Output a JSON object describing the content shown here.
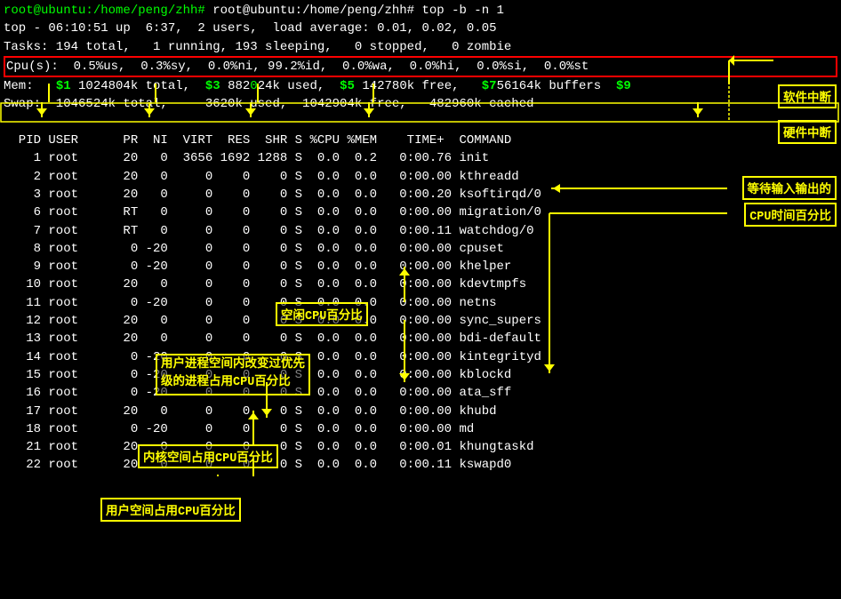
{
  "terminal": {
    "title": "root@ubuntu:/home/peng/zhh# top -b -n 1",
    "lines": {
      "cmd": "root@ubuntu:/home/peng/zhh# top -b -n 1",
      "top_status": "top - 06:10:51 up  6:37,  2 users,  load average: 0.01, 0.02, 0.05",
      "tasks": "Tasks: 194 total,   1 running, 193 sleeping,   0 stopped,   0 zombie",
      "cpu": "Cpu(s):  0.5%us,  0.3%sy,  0.0%ni, 99.2%id,  0.0%wa,  0.0%hi,  0.0%si,  0.0%st",
      "mem": "Mem:   1024804k total,   882024k used,   142780k free,    756164k buffers",
      "swap": "Swap:  1046524k total,     3620k used,  1042904k free,   482960k cached",
      "blank": "",
      "header": "  PID USER      PR  NI  VIRT  RES  SHR S %CPU %MEM    TIME+  COMMAND",
      "p1": "    1 root      20   0  3656 1692 1288 S  0.0  0.2   0:00.76 init",
      "p2": "    2 root      20   0     0    0    0 S  0.0  0.0   0:00.00 kthreadd",
      "p3": "    3 root      20   0     0    0    0 S  0.0  0.0   0:00.20 ksoftirqd/0",
      "p6": "    6 root      RT   0     0    0    0 S  0.0  0.0   0:00.00 migration/0",
      "p7": "    7 root      RT   0     0    0    0 S  0.0  0.0   0:00.11 watchdog/0",
      "p8": "    8 root       0 -20     0    0    0 S  0.0  0.0   0:00.00 cpuset",
      "p9": "    9 root       0 -20     0    0    0 S  0.0  0.0   0:00.00 khelper",
      "p10": "   10 root      20   0     0    0    0 S  0.0  0.0   0:00.00 kdevtmpfs",
      "p11": "   11 root       0 -20     0    0    0 S  0.0  0.0   0:00.00 netns",
      "p12": "   12 root      20   0     0    0    0 S  0.0  0.0   0:00.00 sync_supers",
      "p13": "   13 root      20   0     0    0    0 S  0.0  0.0   0:00.00 bdi-default",
      "p14": "   14 root       0 -20     0    0    0 S  0.0  0.0   0:00.00 kintegrityd",
      "p15": "   15 root       0 -20     0    0    0 S  0.0  0.0   0:00.00 kblockd",
      "p16": "   16 root       0 -20     0    0    0 S  0.0  0.0   0:00.00 ata_sff",
      "p17": "   17 root      20   0     0    0    0 S  0.0  0.0   0:00.00 khubd",
      "p18": "   18 root       0 -20     0    0    0 S  0.0  0.0   0:00.00 md",
      "p21": "   21 root      20   0     0    0    0 S  0.0  0.0   0:00.01 khungtaskd",
      "p22": "   22 root      20   0     0    0    0 S  0.0  0.0   0:00.11 kswapd0"
    },
    "annotations": {
      "dollar1": "$1",
      "dollar3": "$3",
      "dollar5": "$5",
      "dollar7": "$7",
      "dollar9": "$9",
      "software_interrupt": "软件中断",
      "hardware_interrupt": "硬件中断",
      "wait_io": "等待输入输出的",
      "cpu_time_pct": "CPU时间百分比",
      "idle_cpu": "空闲CPU百分比",
      "user_space_changed": "用户进程空间内改变过优先",
      "user_space_changed2": "级的进程占用CPU百分比",
      "kernel_space": "内核空间占用CPU百分比",
      "user_space": "用户空间占用CPU百分比"
    }
  }
}
